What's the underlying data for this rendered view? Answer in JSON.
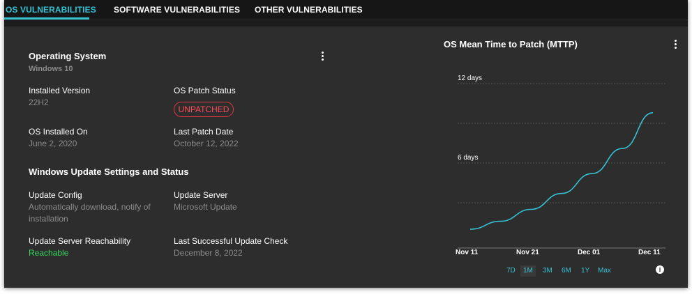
{
  "tabs": [
    {
      "label": "OS VULNERABILITIES"
    },
    {
      "label": "SOFTWARE VULNERABILITIES"
    },
    {
      "label": "OTHER VULNERABILITIES"
    }
  ],
  "os": {
    "title": "Operating System",
    "name": "Windows 10",
    "installed_version_label": "Installed Version",
    "installed_version": "22H2",
    "patch_status_label": "OS Patch Status",
    "patch_status": "UNPATCHED",
    "installed_on_label": "OS Installed On",
    "installed_on": "June 2, 2020",
    "last_patch_label": "Last Patch Date",
    "last_patch": "October 12, 2022"
  },
  "update": {
    "section_title": "Windows Update Settings and Status",
    "config_label": "Update Config",
    "config_line1": "Automatically download, notify of",
    "config_line2": "installation",
    "server_label": "Update Server",
    "server": "Microsoft Update",
    "reach_label": "Update Server Reachability",
    "reach": "Reachable",
    "last_check_label": "Last Successful Update Check",
    "last_check": "December 8, 2022"
  },
  "colors": {
    "accent": "#35c2d4",
    "danger": "#ff4d56",
    "success": "#38d45e"
  },
  "chart": {
    "title": "OS Mean Time to Patch (MTTP)",
    "ranges": [
      "7D",
      "1M",
      "3M",
      "6M",
      "1Y",
      "Max"
    ],
    "selected_range": "1M",
    "info_icon": "info-icon"
  },
  "chart_data": {
    "type": "line",
    "title": "OS Mean Time to Patch (MTTP)",
    "x_tick_labels": [
      "Nov 11",
      "Nov 21",
      "Dec 01",
      "Dec 11"
    ],
    "y_tick_labels": [
      "6 days",
      "12 days"
    ],
    "ylim": [
      0,
      12
    ],
    "grid": true,
    "series": [
      {
        "values": [
          {
            "x": "Nov 11",
            "y": 1.0
          },
          {
            "x": "Nov 16",
            "y": 1.6
          },
          {
            "x": "Nov 21",
            "y": 2.5
          },
          {
            "x": "Nov 26",
            "y": 3.7
          },
          {
            "x": "Dec 01",
            "y": 5.2
          },
          {
            "x": "Dec 06",
            "y": 7.1
          },
          {
            "x": "Dec 11",
            "y": 9.8
          }
        ]
      }
    ]
  }
}
